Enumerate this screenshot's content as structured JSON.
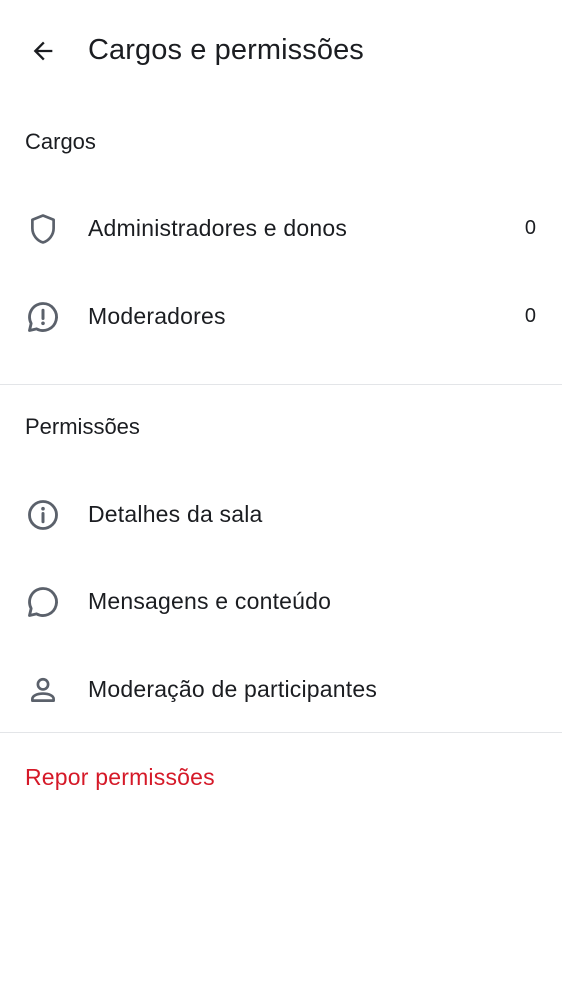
{
  "header": {
    "title": "Cargos e permissões",
    "back_icon": "arrow-left-icon"
  },
  "roles_section": {
    "title": "Cargos",
    "items": [
      {
        "label": "Administradores e donos",
        "count": "0",
        "icon": "shield-icon"
      },
      {
        "label": "Moderadores",
        "count": "0",
        "icon": "speech-bubble-exclamation-icon"
      }
    ]
  },
  "permissions_section": {
    "title": "Permissões",
    "items": [
      {
        "label": "Detalhes da sala",
        "icon": "info-circle-icon"
      },
      {
        "label": "Mensagens e conteúdo",
        "icon": "chat-bubble-icon"
      },
      {
        "label": "Moderação de participantes",
        "icon": "person-icon"
      }
    ]
  },
  "reset": {
    "label": "Repor permissões",
    "color": "#d51928"
  },
  "colors": {
    "icon": "#5b616b",
    "text": "#1b1d21",
    "divider": "#e3e5e8"
  }
}
